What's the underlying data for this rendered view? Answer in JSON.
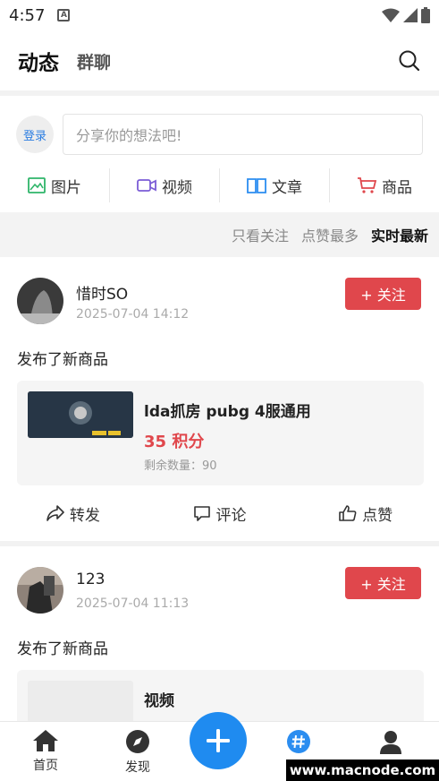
{
  "status_bar": {
    "time": "4:57",
    "notif_icon_text": "A"
  },
  "header": {
    "tab_active": "动态",
    "tab_other": "群聊"
  },
  "composer": {
    "login_label": "登录",
    "placeholder": "分享你的想法吧!"
  },
  "post_types": [
    {
      "label": "图片",
      "icon": "image-icon",
      "color": "#2fb56a"
    },
    {
      "label": "视频",
      "icon": "video-icon",
      "color": "#7b5cd6"
    },
    {
      "label": "文章",
      "icon": "book-icon",
      "color": "#2b8df0"
    },
    {
      "label": "商品",
      "icon": "cart-icon",
      "color": "#e0474c"
    }
  ],
  "filters": [
    {
      "label": "只看关注",
      "active": false
    },
    {
      "label": "点赞最多",
      "active": false
    },
    {
      "label": "实时最新",
      "active": true
    }
  ],
  "posts": [
    {
      "name": "惜时SO",
      "time": "2025-07-04 14:12",
      "follow_label": "+ 关注",
      "text": "发布了新商品",
      "card": {
        "title": "lda抓房 pubg 4服通用",
        "price": "35 积分",
        "stock": "剩余数量：90"
      }
    },
    {
      "name": "123",
      "time": "2025-07-04 11:13",
      "follow_label": "+ 关注",
      "text": "发布了新商品",
      "card": {
        "title": "视频"
      }
    }
  ],
  "actions": {
    "share": "转发",
    "comment": "评论",
    "like": "点赞"
  },
  "tabbar": {
    "home": "首页",
    "discover": "发现",
    "square": "广场",
    "mine": "我的",
    "active_color": "#2b8df0"
  },
  "watermark": "www.macnode.com"
}
